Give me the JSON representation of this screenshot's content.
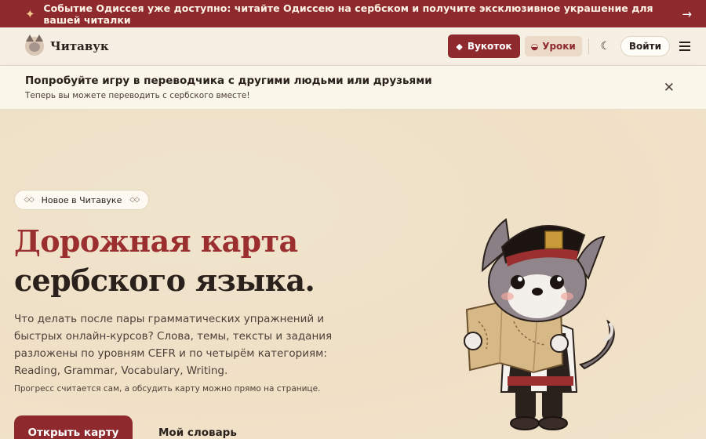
{
  "announcement": {
    "text": "Событие Одиссея уже доступно: читайте Одиссею на сербском и получите эксклюзивное украшение для вашей читалки",
    "icon": "sparkle-icon",
    "arrow_icon": "arrow-right-icon"
  },
  "header": {
    "brand": "Читавук",
    "vukotok_label": "Вукоток",
    "lessons_label": "Уроки",
    "login_label": "Войти",
    "theme_icon": "moon-icon",
    "menu_icon": "hamburger-icon"
  },
  "notice": {
    "title": "Попробуйте игру в переводчика с другими людьми или друзьями",
    "subtitle": "Теперь вы можете переводить с сербского вместе!"
  },
  "hero": {
    "badge": "Новое в Читавуке",
    "headline_accent": "Дорожная карта",
    "headline_rest": "сербского языка.",
    "lead": "Что делать после пары грамматических упражнений и быстрых онлайн-курсов? Слова, темы, тексты и задания разложены по уровням CEFR и по четырём категориям: Reading, Grammar, Vocabulary, Writing.",
    "note": "Прогресс считается сам, а обсудить карту можно прямо на странице.",
    "cta_primary": "Открыть карту",
    "cta_secondary": "Мой словарь"
  },
  "colors": {
    "brand": "#8e2a2e",
    "accent_text": "#9b2e2e",
    "background": "#f3e9d6"
  }
}
